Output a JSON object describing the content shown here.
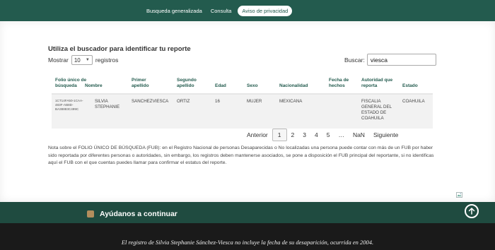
{
  "nav": {
    "items": [
      {
        "label": "Busqueda generalizada"
      },
      {
        "label": "Consulta"
      },
      {
        "label": "Aviso de privacidad"
      }
    ]
  },
  "search_panel": {
    "heading": "Utiliza el buscador para identificar tu reporte",
    "show_label": "Mostrar",
    "page_length": "10",
    "records_label": "registros",
    "search_label": "Buscar:",
    "search_value": "viesca"
  },
  "table": {
    "headers": [
      "Folio único de búsqueda",
      "Nombre",
      "Primer apellido",
      "Segundo apellido",
      "Edad",
      "Sexo",
      "Nacionalidad",
      "Fecha de hechos",
      "Autoridad que reporta",
      "Estado"
    ],
    "rows": [
      {
        "fub": "1CT14FA50-1CAA-483F-AB8D-BA38883C499C",
        "nombre": "SILVIA STEPHANIE",
        "primer_apellido": "SANCHEZVIESCA",
        "segundo_apellido": "ORTIZ",
        "edad": "16",
        "sexo": "MUJER",
        "nacionalidad": "MEXICANA",
        "fecha_hechos": "",
        "autoridad": "FISCALIA GENERAL DEL ESTADO DE COAHUILA",
        "estado": "COAHUILA"
      }
    ]
  },
  "pagination": {
    "previous": "Anterior",
    "pages": [
      "1",
      "2",
      "3",
      "4",
      "5"
    ],
    "ellipsis": "…",
    "last": "NaN",
    "next": "Siguiente",
    "current": "1"
  },
  "note": "Nota sobre el FOLIO ÚNICO DE BÚSQUEDA (FUB): en el Registro Nacional de personas Desaparecidas o No localizadas una persona puede contar con más de un FUB por haber sido reportada por diferentes personas o autoridades, sin embargo, los registros deben mantenerse asociados, se pone a disposición el FUB principal del reportante, si no identificas aquí el FUB con el que cuentas puedes llamar para confirmar el estatus del reporte.",
  "footer": {
    "help_text": "Ayúdanos a continuar"
  },
  "caption": "El registro de Silvia Stephanie Sánchez-Viesca no incluye la fecha de su desaparición, ocurrida en 2004.",
  "colors": {
    "brand_green": "#235b4e",
    "dark_green": "#1f4b40",
    "accent_gold": "#b38e5d"
  },
  "icons": {
    "length_select": "chevron-down-icon",
    "scroll_top": "arrow-up-icon",
    "broken_image": "broken-image-icon",
    "help": "help-badge-icon"
  }
}
